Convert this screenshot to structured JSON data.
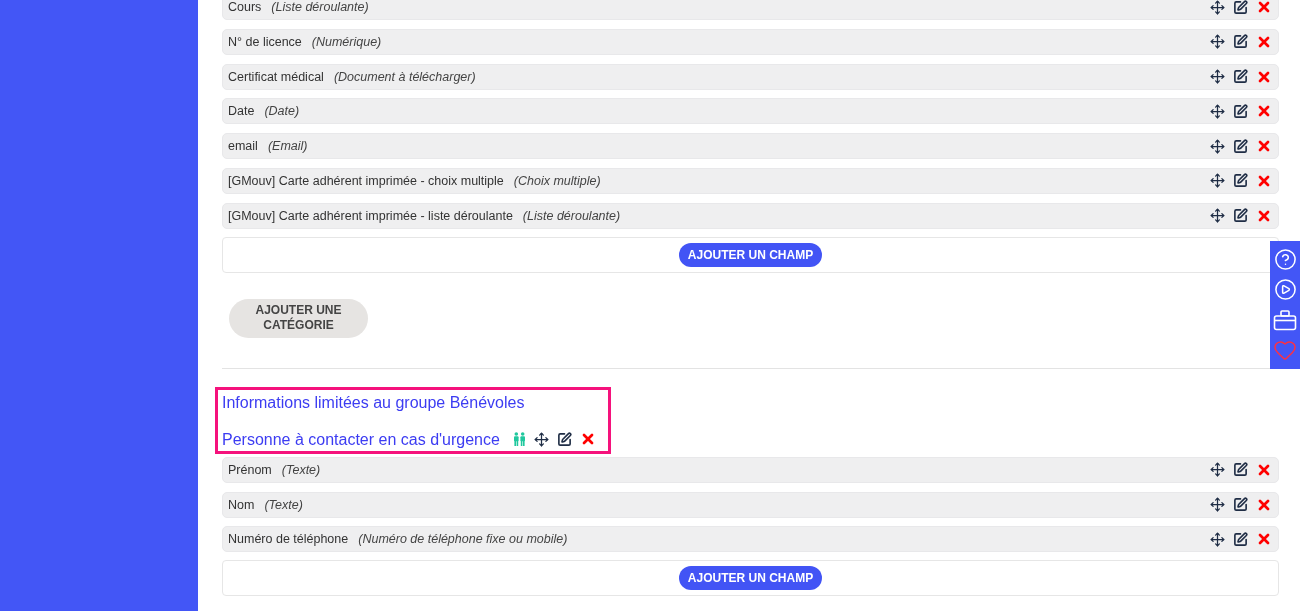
{
  "first_category": {
    "fields": [
      {
        "name": "Cours",
        "type": "(Liste déroulante)"
      },
      {
        "name": "N° de licence",
        "type": "(Numérique)"
      },
      {
        "name": "Certificat médical",
        "type": "(Document à télécharger)"
      },
      {
        "name": "Date",
        "type": "(Date)"
      },
      {
        "name": "email",
        "type": "(Email)"
      },
      {
        "name": "[GMouv] Carte adhérent imprimée - choix multiple",
        "type": "(Choix multiple)"
      },
      {
        "name": "[GMouv] Carte adhérent imprimée - liste déroulante",
        "type": "(Liste déroulante)"
      }
    ],
    "add_field_button": "AJOUTER UN CHAMP"
  },
  "add_category_button": "AJOUTER UNE CATÉGORIE",
  "group_category": {
    "notice": "Informations limitées au groupe Bénévoles",
    "title": "Personne à contacter en cas d'urgence",
    "fields": [
      {
        "name": "Prénom",
        "type": "(Texte)"
      },
      {
        "name": "Nom",
        "type": "(Texte)"
      },
      {
        "name": "Numéro de téléphone",
        "type": "(Numéro de téléphone fixe ou mobile)"
      }
    ],
    "add_field_button": "AJOUTER UN CHAMP"
  }
}
